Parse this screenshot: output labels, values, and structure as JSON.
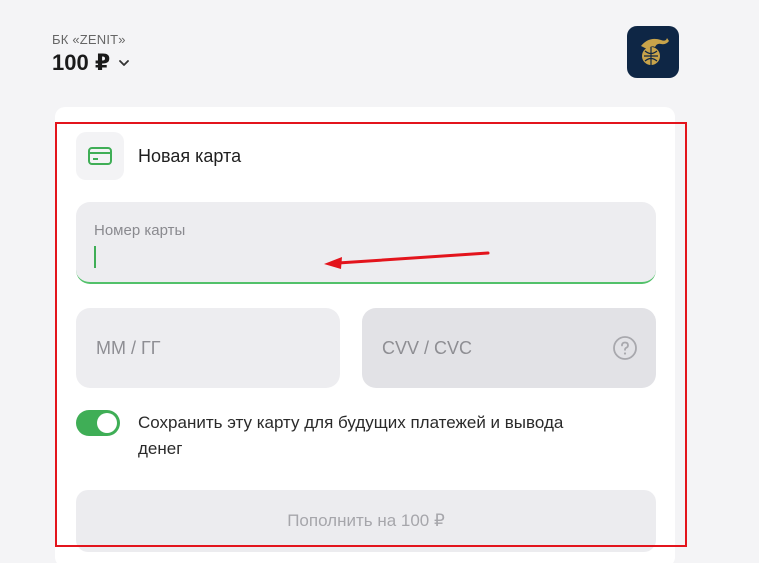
{
  "merchant": {
    "name": "БК «ZENIT»",
    "amount": "100 ₽",
    "logo_icon": "zenit-club-logo-icon"
  },
  "form": {
    "card_type_label": "Новая карта",
    "card_icon": "credit-card-icon",
    "card_number": {
      "label": "Номер карты",
      "value": ""
    },
    "expiry": {
      "placeholder": "ММ / ГГ"
    },
    "cvv": {
      "placeholder": "CVV / CVC",
      "help_icon": "question-circle-icon"
    },
    "save_card": {
      "enabled": true,
      "label": "Сохранить эту карту для будущих платежей и вывода денег"
    },
    "submit_label": "Пополнить на 100 ₽"
  },
  "annotation": {
    "frame_color": "#e3141c",
    "arrow_color": "#e3141c"
  },
  "colors": {
    "accent": "#3fae56",
    "logo_bg": "#0e2645"
  }
}
